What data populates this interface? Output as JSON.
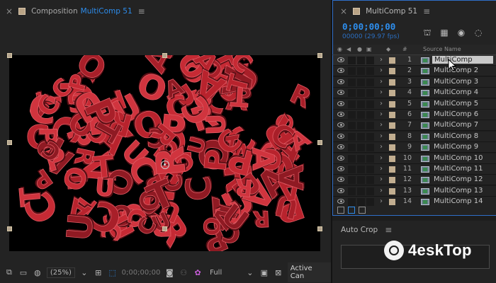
{
  "composition_panel": {
    "header": {
      "close": "×",
      "label": "Composition",
      "name": "MultiComp 51",
      "menu": "≡"
    },
    "footer": {
      "zoom": "(25%)",
      "timecode": "0;00;00;00",
      "resolution": "Full",
      "camera": "Active Can"
    }
  },
  "timeline_panel": {
    "header": {
      "close": "×",
      "title": "MultiComp 51",
      "menu": "≡"
    },
    "timecode": "0;00;00;00",
    "fps": "00000 (29.97 fps)",
    "columns": {
      "number": "#",
      "source": "Source Name"
    },
    "layers": [
      {
        "num": "1",
        "name": "MultiComp"
      },
      {
        "num": "2",
        "name": "MultiComp 2"
      },
      {
        "num": "3",
        "name": "MultiComp 3"
      },
      {
        "num": "4",
        "name": "MultiComp 4"
      },
      {
        "num": "5",
        "name": "MultiComp 5"
      },
      {
        "num": "6",
        "name": "MultiComp 6"
      },
      {
        "num": "7",
        "name": "MultiComp 7"
      },
      {
        "num": "8",
        "name": "MultiComp 8"
      },
      {
        "num": "9",
        "name": "MultiComp 9"
      },
      {
        "num": "10",
        "name": "MultiComp 10"
      },
      {
        "num": "11",
        "name": "MultiComp 11"
      },
      {
        "num": "12",
        "name": "MultiComp 12"
      },
      {
        "num": "13",
        "name": "MultiComp 13"
      },
      {
        "num": "14",
        "name": "MultiComp 14"
      }
    ],
    "selected_layer": "1"
  },
  "auto_crop_panel": {
    "title": "Auto Crop",
    "menu": "≡"
  },
  "watermark": {
    "text": "4eskTop"
  },
  "colors": {
    "accent_blue": "#2d8ceb",
    "panel_bg": "#232323",
    "label_swatch": "#c2ae90",
    "letter_red": "#c62a34"
  },
  "canvas": {
    "letters": [
      "C",
      "R",
      "O",
      "P",
      "A",
      "U",
      "T"
    ]
  }
}
